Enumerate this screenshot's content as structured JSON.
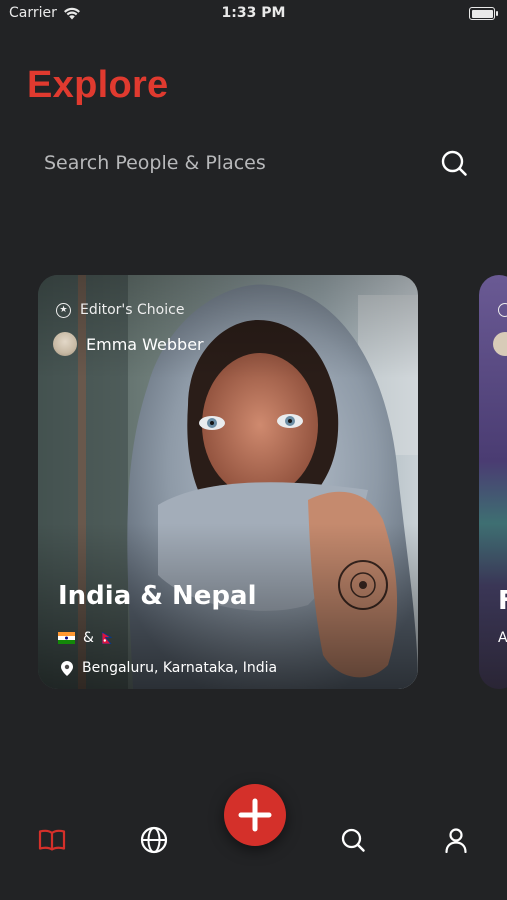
{
  "status_bar": {
    "carrier": "Carrier",
    "time": "1:33 PM"
  },
  "header": {
    "title": "Explore"
  },
  "search": {
    "placeholder": "Search People & Places"
  },
  "cards": [
    {
      "badge": "Editor's Choice",
      "author": "Emma Webber",
      "title": "India & Nepal",
      "flags_separator": "&",
      "location": "Bengaluru, Karnataka, India"
    },
    {
      "title_partial": "F",
      "location_partial": "A"
    }
  ],
  "tab_bar": {
    "items": [
      "book-icon",
      "globe-icon",
      "add-icon",
      "search-icon",
      "user-icon"
    ],
    "active": "book-icon",
    "accent": "#d4302a"
  },
  "colors": {
    "background": "#222325",
    "accent": "#e03a2f",
    "text_muted": "#b7b8ba"
  }
}
